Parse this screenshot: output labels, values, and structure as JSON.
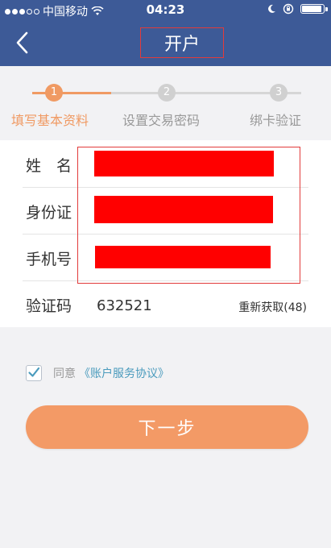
{
  "status_bar": {
    "carrier": "中国移动",
    "time": "04:23"
  },
  "nav": {
    "title": "开户"
  },
  "steps": [
    {
      "number": "1",
      "label": "填写基本资料",
      "active": true
    },
    {
      "number": "2",
      "label": "设置交易密码",
      "active": false
    },
    {
      "number": "3",
      "label": "绑卡验证",
      "active": false
    }
  ],
  "form": {
    "name_label": "姓　名",
    "id_label": "身份证",
    "phone_label": "手机号",
    "code_label": "验证码",
    "code_value": "632521",
    "resend_label": "重新获取(48)"
  },
  "agreement": {
    "checked": true,
    "agree_text": "同意",
    "link_text": "《账户服务协议》"
  },
  "next_button": {
    "label": "下一步"
  },
  "colors": {
    "header": "#3d5a97",
    "accent": "#f39a66",
    "link": "#4a9bbd",
    "redaction": "#ff0000"
  }
}
